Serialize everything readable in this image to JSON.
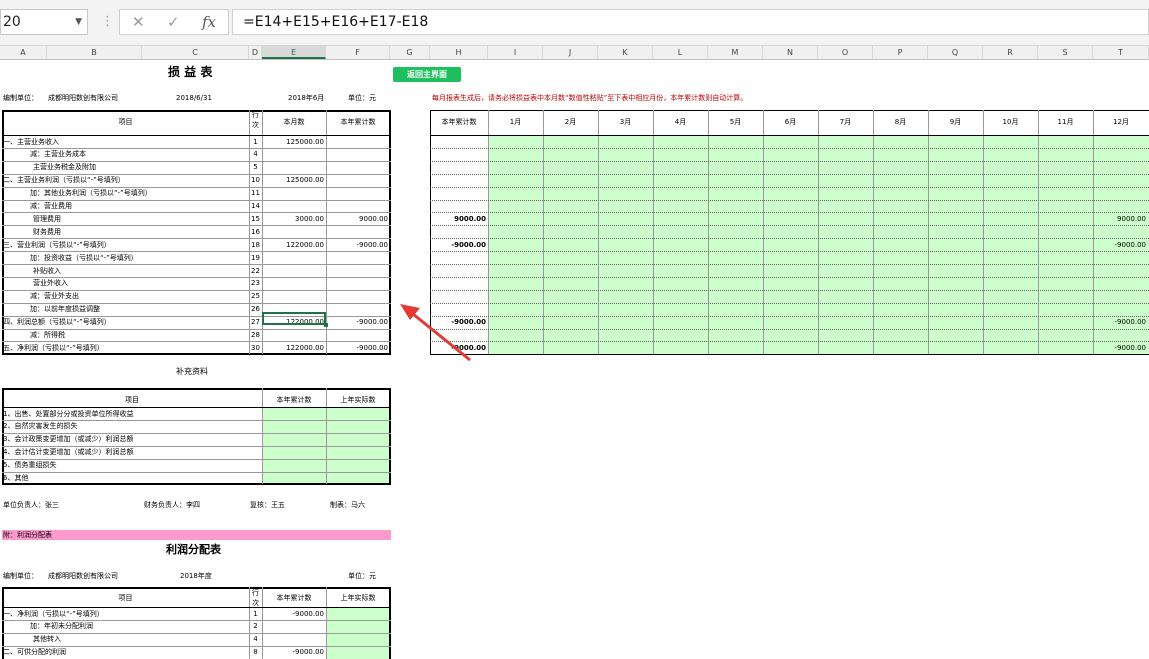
{
  "formula_bar": {
    "name_box": "20",
    "formula": "=E14+E15+E16+E17-E18"
  },
  "columns": [
    "A",
    "B",
    "C",
    "D",
    "E",
    "F",
    "G",
    "H",
    "I",
    "J",
    "K",
    "L",
    "M",
    "N",
    "O",
    "P",
    "Q",
    "R",
    "S",
    "T"
  ],
  "button_label": "返回主界面",
  "income": {
    "title": "损 益 表",
    "unit_label": "编制单位：",
    "company": "成都明阳数创有限公司",
    "date": "2018/6/31",
    "period": "2018年6月",
    "currency": "单位：元",
    "headers": {
      "item": "项目",
      "line": "行次",
      "month": "本月数",
      "ytd": "本年累计数"
    },
    "rows": [
      {
        "item": "一、主营业务收入",
        "line": "1",
        "month": "125000.00",
        "ytd": ""
      },
      {
        "item": "减：主营业务成本",
        "line": "4",
        "month": "",
        "ytd": ""
      },
      {
        "item": "主营业务税金及附加",
        "line": "5",
        "month": "",
        "ytd": ""
      },
      {
        "item": "二、主营业务利润（亏损以“-”号填列）",
        "line": "10",
        "month": "125000.00",
        "ytd": ""
      },
      {
        "item": "加：其他业务利润（亏损以“-”号填列）",
        "line": "11",
        "month": "",
        "ytd": ""
      },
      {
        "item": "减：营业费用",
        "line": "14",
        "month": "",
        "ytd": ""
      },
      {
        "item": "管理费用",
        "line": "15",
        "month": "3000.00",
        "ytd": "9000.00"
      },
      {
        "item": "财务费用",
        "line": "16",
        "month": "",
        "ytd": ""
      },
      {
        "item": "三、营业利润（亏损以“-”号填列）",
        "line": "18",
        "month": "122000.00",
        "ytd": "-9000.00"
      },
      {
        "item": "加：投资收益（亏损以“-”号填列）",
        "line": "19",
        "month": "",
        "ytd": ""
      },
      {
        "item": "补贴收入",
        "line": "22",
        "month": "",
        "ytd": ""
      },
      {
        "item": "营业外收入",
        "line": "23",
        "month": "",
        "ytd": ""
      },
      {
        "item": "减：营业外支出",
        "line": "25",
        "month": "",
        "ytd": ""
      },
      {
        "item": "加：以前年度损益调整",
        "line": "26",
        "month": "",
        "ytd": ""
      },
      {
        "item": "四、利润总额（亏损以“-”号填列）",
        "line": "27",
        "month": "122000.00",
        "ytd": "-9000.00"
      },
      {
        "item": "减：所得税",
        "line": "28",
        "month": "",
        "ytd": ""
      },
      {
        "item": "五、净利润（亏损以“-”号填列）",
        "line": "30",
        "month": "122000.00",
        "ytd": "-9000.00"
      }
    ]
  },
  "note": "每月报表生成后，请务必将损益表中本月数“数值性粘贴”至下表中相应月份，本年累计数则自动计算。",
  "monthly": {
    "headers": [
      "本年累计数",
      "1月",
      "2月",
      "3月",
      "4月",
      "5月",
      "6月",
      "7月",
      "8月",
      "9月",
      "10月",
      "11月",
      "12月"
    ],
    "ytd": [
      "",
      "",
      "",
      "",
      "",
      "",
      "9000.00",
      "",
      "-9000.00",
      "",
      "",
      "",
      "",
      "",
      "-9000.00",
      "",
      "-9000.00"
    ],
    "dec": [
      "",
      "",
      "",
      "",
      "",
      "",
      "9000.00",
      "",
      "-9000.00",
      "",
      "",
      "",
      "",
      "",
      "-9000.00",
      "",
      "-9000.00"
    ]
  },
  "supplement": {
    "title": "补充资料",
    "headers": {
      "item": "项目",
      "ytd": "本年累计数",
      "prev": "上年实际数"
    },
    "rows": [
      "1、出售、处置部分分或投资单位所得收益",
      "2、自然灾害发生的损失",
      "3、会计政策变更增加（或减少）利润总额",
      "4、会计估计变更增加（或减少）利润总额",
      "5、债务重组损失",
      "6、其他"
    ]
  },
  "signatures": {
    "head": "单位负责人：张三",
    "finance": "财务负责人：李四",
    "review": "复核：王五",
    "maker": "制表：马六"
  },
  "appendix_label": "附：利润分配表",
  "distribution": {
    "title": "利润分配表",
    "unit_label": "编制单位：",
    "company": "成都明阳数创有限公司",
    "period": "2018年度",
    "currency": "单位：元",
    "headers": {
      "item": "项目",
      "line": "行次",
      "ytd": "本年累计数",
      "prev": "上年实际数"
    },
    "rows": [
      {
        "item": "一、净利润（亏损以“-”号填列）",
        "line": "1",
        "ytd": "-9000.00"
      },
      {
        "item": "加：年初未分配利润",
        "line": "2",
        "ytd": ""
      },
      {
        "item": "其他转入",
        "line": "4",
        "ytd": ""
      },
      {
        "item": "二、可供分配的利润",
        "line": "8",
        "ytd": "-9000.00"
      }
    ]
  },
  "colors": {
    "green_fill": "#ccffcc",
    "pink_fill": "#ff99cc",
    "button": "#1fbf5f",
    "note_text": "#c00000",
    "select": "#217346"
  },
  "icons": [
    "cancel-icon",
    "confirm-icon",
    "function-icon",
    "arrow-annotation"
  ]
}
